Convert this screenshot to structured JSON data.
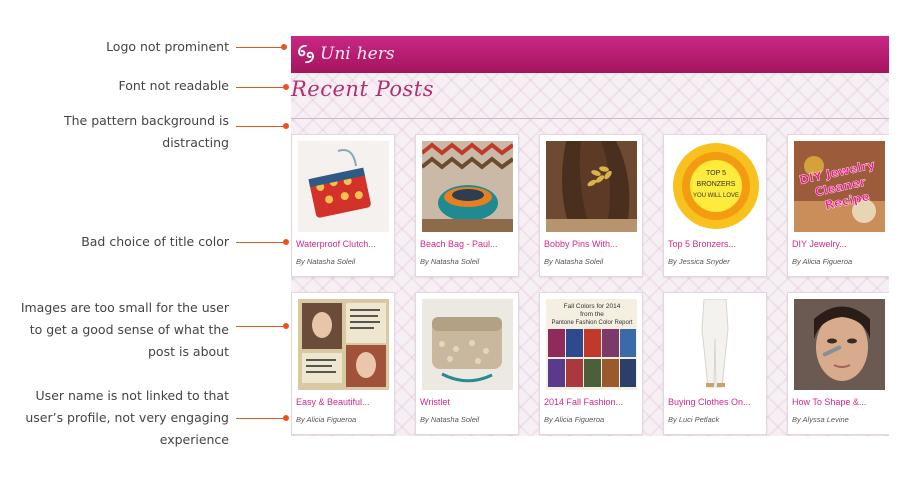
{
  "annotations": {
    "logo": "Logo not prominent",
    "font": "Font not readable",
    "pattern_line1": "The pattern background is",
    "pattern_line2": "distracting",
    "title_color": "Bad choice of title color",
    "images_line1": "Images are too small for the user",
    "images_line2": "to get a good sense of what the",
    "images_line3": "post is about",
    "user_line1": "User name is not linked to that",
    "user_line2": "user’s profile,  not very engaging",
    "user_line3": "experience"
  },
  "header": {
    "logo_text": "Uni",
    "logo_text2": "hers",
    "accent": "#b81d72"
  },
  "section_title": "Recent Posts",
  "colors": {
    "title_pink": "#d2288a",
    "leader": "#e8531f"
  },
  "posts": [
    {
      "title": "Waterproof Clutch...",
      "author": "By Natasha Soleil"
    },
    {
      "title": "Beach Bag - Paul...",
      "author": "By Natasha Soleil"
    },
    {
      "title": "Bobby Pins With...",
      "author": "By Natasha Soleil"
    },
    {
      "title": "Top 5 Bronzers...",
      "author": "By Jessica Snyder"
    },
    {
      "title": "DIY Jewelry...",
      "author": "By Alicia Figueroa"
    },
    {
      "title": "Easy & Beautiful...",
      "author": "By Alicia Figueroa"
    },
    {
      "title": "Wristlet",
      "author": "By Natasha Soleil"
    },
    {
      "title": "2014 Fall Fashion...",
      "author": "By Alicia Figueroa"
    },
    {
      "title": "Buying Clothes On...",
      "author": "By Luci Petlack"
    },
    {
      "title": "How To Shape &...",
      "author": "By Alyssa Levine"
    }
  ],
  "thumb_text": {
    "bronzer_line1": "TOP 5",
    "bronzer_line2": "BRONZERS",
    "bronzer_line3": "YOU WILL LOVE",
    "jewelry": "DIY Jewelry Cleaner Recipe",
    "pantone_line1": "Fall Colors for 2014",
    "pantone_line2": "from the",
    "pantone_line3": "Pantone Fashion Color Report"
  }
}
